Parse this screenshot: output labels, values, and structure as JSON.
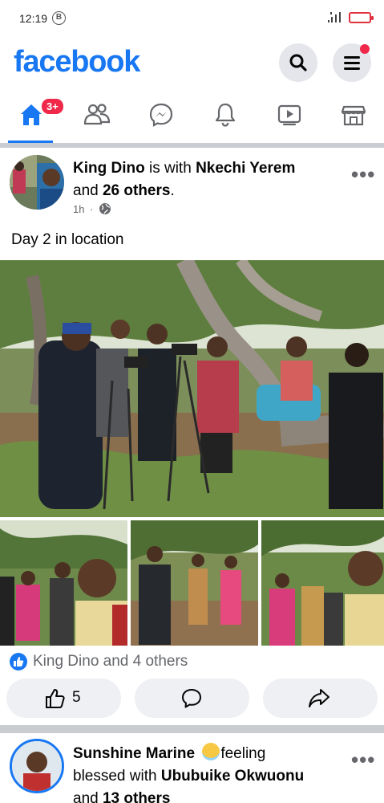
{
  "status_bar": {
    "time": "12:19",
    "b_badge": "B"
  },
  "header": {
    "logo": "facebook",
    "search_icon": "search-icon",
    "menu_icon": "hamburger-menu-icon"
  },
  "tabs": [
    {
      "name": "home",
      "icon": "home-icon",
      "badge": "3+",
      "active": true
    },
    {
      "name": "friends",
      "icon": "friends-icon"
    },
    {
      "name": "messenger",
      "icon": "messenger-icon"
    },
    {
      "name": "notifications",
      "icon": "bell-icon"
    },
    {
      "name": "watch",
      "icon": "video-icon"
    },
    {
      "name": "marketplace",
      "icon": "store-icon"
    }
  ],
  "post1": {
    "author": "King Dino",
    "with_text": " is with ",
    "tagged": "Nkechi Yerem",
    "and_text": "and ",
    "others": "26 others",
    "period": ".",
    "time": "1h",
    "dot": "·",
    "privacy_icon": "globe-icon",
    "text": "Day 2 in location",
    "reactions_text": "King Dino and 4 others",
    "like_count": "5"
  },
  "post2": {
    "author": "Sunshine Marine",
    "feeling": "feeling",
    "feeling_line2": "blessed with ",
    "tagged": "Ububuike Okwuonu",
    "and_text": "and ",
    "others": "13 others"
  },
  "colors": {
    "brand": "#1877f2",
    "badge": "#f02849",
    "muted": "#65676b"
  }
}
